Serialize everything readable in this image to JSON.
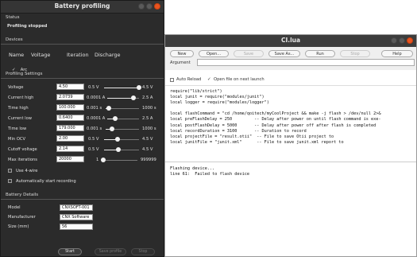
{
  "bp": {
    "title": "Battery profiling",
    "status_heading": "Status",
    "status_text": "Profiling stopped",
    "devices_heading": "Devices",
    "devices_columns": [
      "Name",
      "Voltage",
      "Iteration",
      "Discharge"
    ],
    "device_row": "Arc",
    "settings_heading": "Profiling Settings",
    "settings": [
      {
        "label": "Voltage",
        "value": "4.50",
        "min": "0.5 V",
        "max": "4.5 V",
        "level": 1.0
      },
      {
        "label": "Current high",
        "value": "2.0739",
        "min": "0.0001 A",
        "max": "2.5 A",
        "level": 0.83
      },
      {
        "label": "Time high",
        "value": "100.000",
        "min": "0.001 s",
        "max": "1000 s",
        "level": 0.1
      },
      {
        "label": "Current low",
        "value": "0.6400",
        "min": "0.0001 A",
        "max": "2.5 A",
        "level": 0.26
      },
      {
        "label": "Time low",
        "value": "179.000",
        "min": "0.001 s",
        "max": "1000 s",
        "level": 0.18
      },
      {
        "label": "Min OCV",
        "value": "2.00",
        "min": "0.5 V",
        "max": "4.5 V",
        "level": 0.38
      },
      {
        "label": "Cutoff voltage",
        "value": "2.14",
        "min": "0.5 V",
        "max": "4.5 V",
        "level": 0.41
      },
      {
        "label": "Max iterations",
        "value": "20000",
        "min": "1",
        "max": "999999",
        "level": 0.02
      }
    ],
    "use_4wire": "Use 4-wire",
    "auto_start": "Automatically start recording",
    "details_heading": "Battery Details",
    "details": [
      {
        "label": "Model",
        "value": "CNXSOFT-001"
      },
      {
        "label": "Manufacturer",
        "value": "CNX Software"
      },
      {
        "label": "Size (mm)",
        "value": "56"
      }
    ],
    "buttons": {
      "start": "Start",
      "save": "Save profile",
      "stop": "Stop"
    }
  },
  "ci": {
    "title": "CI.lua",
    "buttons": {
      "new": "New",
      "open": "Open...",
      "save": "Save",
      "save_as": "Save As...",
      "run": "Run",
      "stop": "Stop",
      "help": "Help"
    },
    "argument_label": "Argument",
    "argument_value": "",
    "auto_reload": "Auto Reload",
    "open_on_launch": "Open file on next launch",
    "code": "require(\"lib/strict\")\nlocal junit = require(\"modules/junit\")\nlocal logger = require(\"modules/logger\")\n\nlocal flashCommand = \"cd /home/qoitech/myCoolProject && make -j flash > /dev/null 2>&\nlocal preFlashDelay = 250         -- Delay after power on until flash command is exe-\nlocal postFlashDelay = 5000       -- Delay after power off after flash is completed\nlocal recordDuration = 3100       -- Duration to record\nlocal projectFile = \"result.otii\"  -- File to save Otii project to\nlocal junitFile = \"junit.xml\"      -- File to save junit.xml report to",
    "output": "Flashing device...\nline 61:  Failed to flash device"
  }
}
